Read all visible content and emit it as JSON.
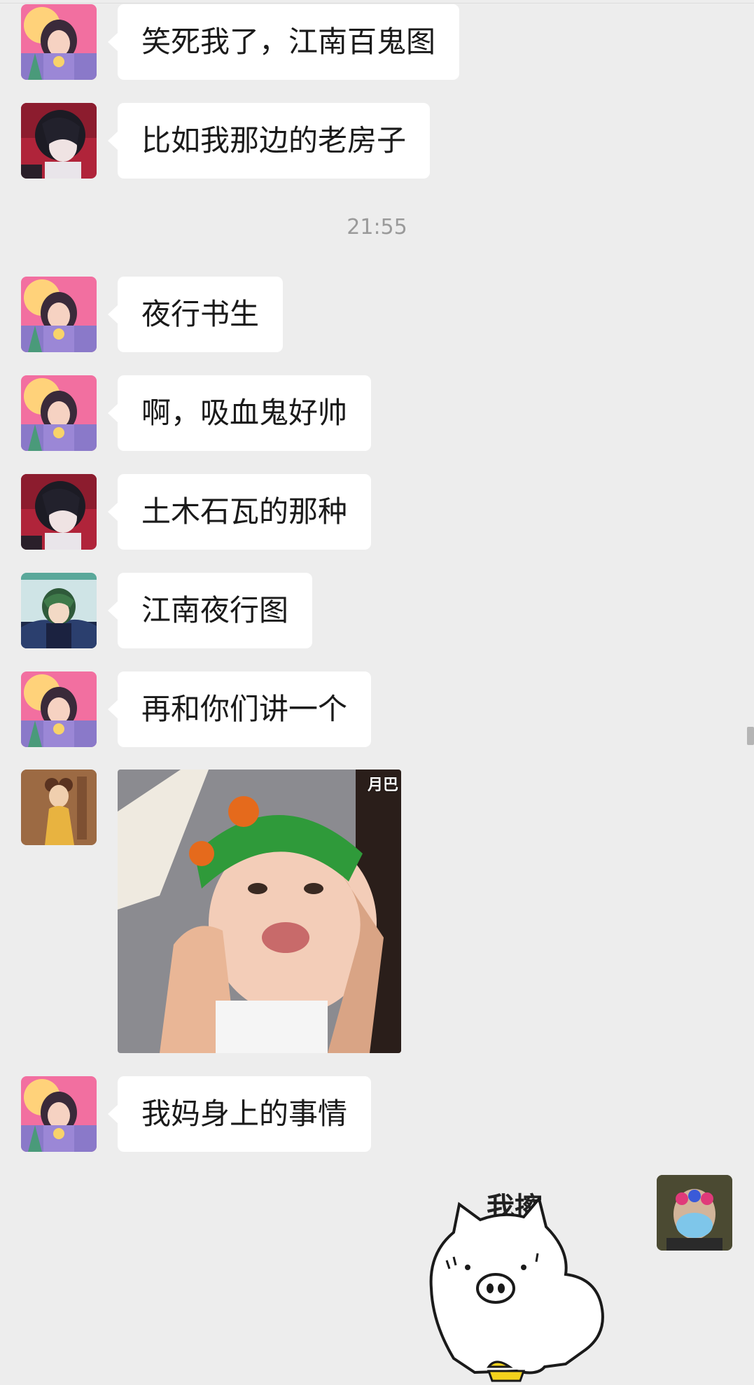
{
  "messages": [
    {
      "sender": "user-a",
      "text": "笑死我了，江南百鬼图"
    },
    {
      "sender": "user-b",
      "text": "比如我那边的老房子"
    },
    {
      "sender": "user-a",
      "text": "夜行书生"
    },
    {
      "sender": "user-a",
      "text": "啊，吸血鬼好帅"
    },
    {
      "sender": "user-b",
      "text": "土木石瓦的那种"
    },
    {
      "sender": "user-c",
      "text": "江南夜行图"
    },
    {
      "sender": "user-a",
      "text": "再和你们讲一个"
    },
    {
      "sender": "user-a",
      "text": "我妈身上的事情"
    }
  ],
  "timestamp": "21:55",
  "photo": {
    "watermark": "月巴"
  },
  "sticker": {
    "text": "我擦"
  },
  "colors": {
    "background": "#ededed",
    "bubble": "#ffffff",
    "timestamp": "#9a9a9a"
  },
  "icons": {
    "avatar_a": "anime-girl-avatar",
    "avatar_b": "dark-hair-boy-avatar",
    "avatar_c": "green-hair-boy-avatar",
    "avatar_d": "golden-girl-avatar",
    "avatar_self": "masked-face-avatar",
    "sticker": "pig-sticker"
  }
}
